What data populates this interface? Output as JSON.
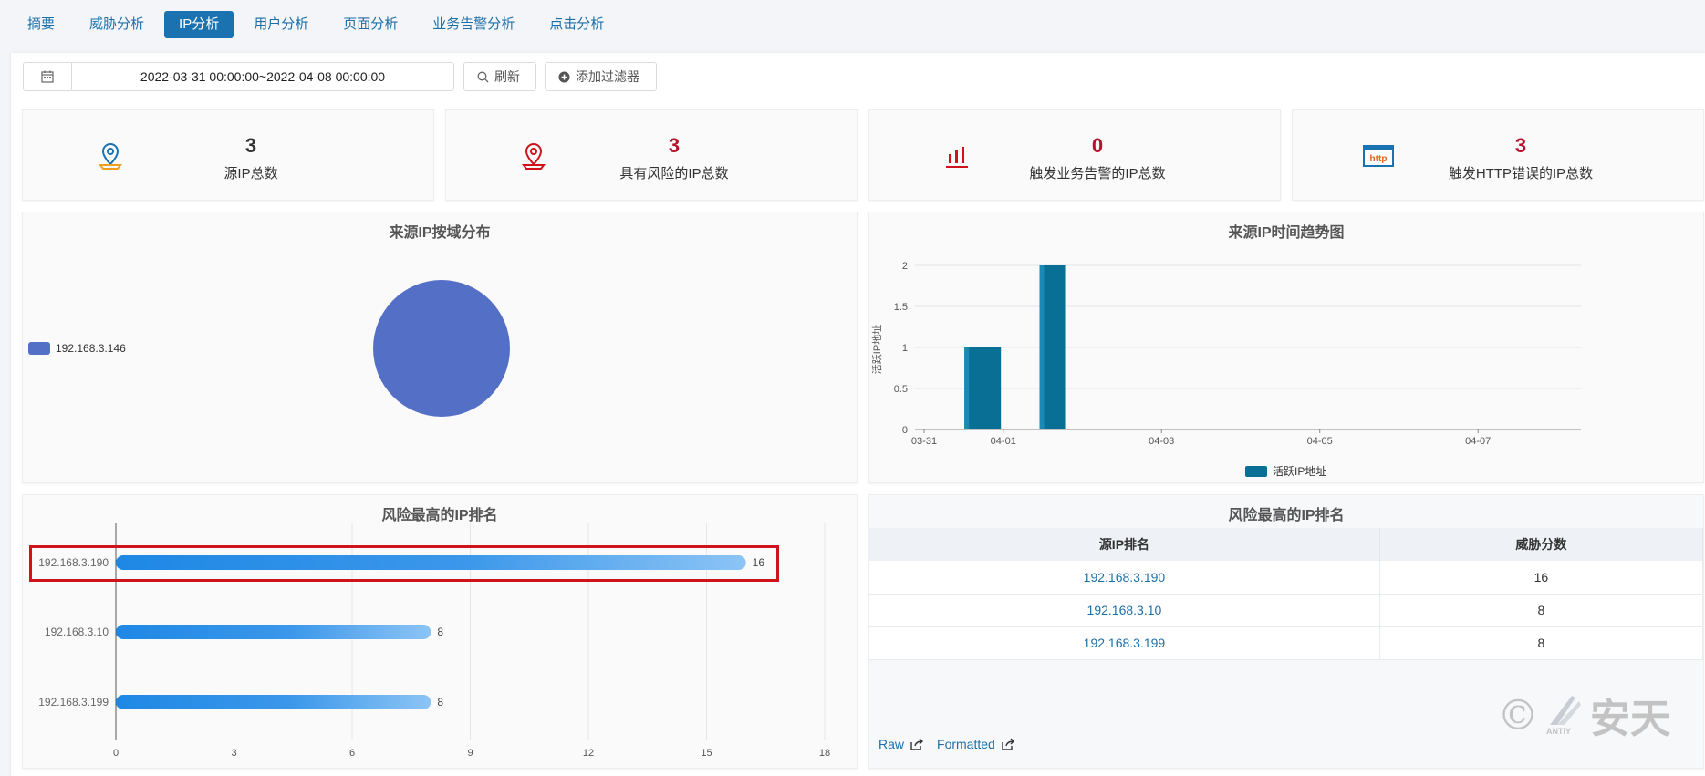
{
  "tabs": [
    {
      "label": "摘要",
      "active": false
    },
    {
      "label": "威胁分析",
      "active": false
    },
    {
      "label": "IP分析",
      "active": true
    },
    {
      "label": "用户分析",
      "active": false
    },
    {
      "label": "页面分析",
      "active": false
    },
    {
      "label": "业务告警分析",
      "active": false
    },
    {
      "label": "点击分析",
      "active": false
    }
  ],
  "toolbar": {
    "date_range": "2022-03-31 00:00:00~2022-04-08 00:00:00",
    "refresh_label": "刷新",
    "add_filter_label": "添加过滤器",
    "calendar_icon": "calendar-icon"
  },
  "stats": [
    {
      "value": "3",
      "label": "源IP总数",
      "icon": "location-pin-icon",
      "color": "#000000"
    },
    {
      "value": "3",
      "label": "具有风险的IP总数",
      "icon": "risk-location-icon",
      "color": "#b8102a"
    },
    {
      "value": "0",
      "label": "触发业务告警的IP总数",
      "icon": "bar-alert-icon",
      "color": "#b8102a"
    },
    {
      "value": "3",
      "label": "触发HTTP错误的IP总数",
      "icon": "http-error-icon",
      "color": "#b8102a"
    }
  ],
  "http_icon_text": "http",
  "pie_panel": {
    "title": "来源IP按域分布",
    "legend": "192.168.3.146"
  },
  "trend_panel": {
    "title": "来源IP时间趋势图",
    "ylabel": "活跃IP地址",
    "legend": "活跃IP地址"
  },
  "risk_bar_panel": {
    "title": "风险最高的IP排名"
  },
  "risk_table": {
    "title": "风险最高的IP排名",
    "headers": [
      "源IP排名",
      "威胁分数"
    ],
    "rows": [
      [
        "192.168.3.190",
        "16"
      ],
      [
        "192.168.3.10",
        "8"
      ],
      [
        "192.168.3.199",
        "8"
      ]
    ],
    "raw_label": "Raw",
    "formatted_label": "Formatted"
  },
  "watermark": {
    "copyright": "©",
    "brand": "安天",
    "sub": "ANTIY"
  },
  "colors": {
    "accent": "#1a73b0",
    "pie": "#5470c6",
    "bar_blue": "#1e88e5",
    "trend_bar": "#0a6f94",
    "highlight": "#d0131a"
  },
  "chart_data": [
    {
      "type": "pie",
      "title": "来源IP按域分布",
      "slices": [
        {
          "label": "192.168.3.146",
          "value": 1
        }
      ]
    },
    {
      "type": "bar",
      "title": "来源IP时间趋势图",
      "ylabel": "活跃IP地址",
      "x_ticks": [
        "03-31",
        "04-01",
        "04-03",
        "04-05",
        "04-07"
      ],
      "y_ticks": [
        "0",
        "0.5",
        "1",
        "1.5",
        "2"
      ],
      "ylim": [
        0,
        2
      ],
      "series": [
        {
          "name": "活跃IP地址",
          "x": [
            "04-01",
            "04-02"
          ],
          "values": [
            1,
            2
          ]
        }
      ]
    },
    {
      "type": "bar",
      "orientation": "horizontal",
      "title": "风险最高的IP排名",
      "categories": [
        "192.168.3.190",
        "192.168.3.10",
        "192.168.3.199"
      ],
      "values": [
        16,
        8,
        8
      ],
      "x_ticks": [
        "0",
        "3",
        "6",
        "9",
        "12",
        "15",
        "18"
      ],
      "xlim": [
        0,
        18
      ]
    }
  ]
}
